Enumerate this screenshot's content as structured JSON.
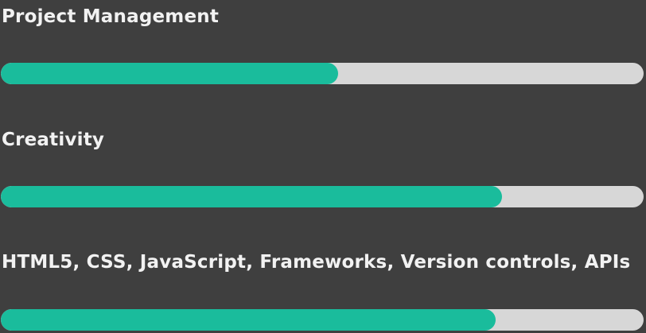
{
  "skills": [
    {
      "label": "Project Management",
      "percent": 52.5
    },
    {
      "label": "Creativity",
      "percent": 78
    },
    {
      "label": "HTML5, CSS, JavaScript, Frameworks, Version controls, APIs",
      "percent": 77
    }
  ],
  "colors": {
    "background": "#3f3f3f",
    "track": "#d7d7d7",
    "fill": "#1abc9c",
    "text": "#f2f2f2"
  }
}
